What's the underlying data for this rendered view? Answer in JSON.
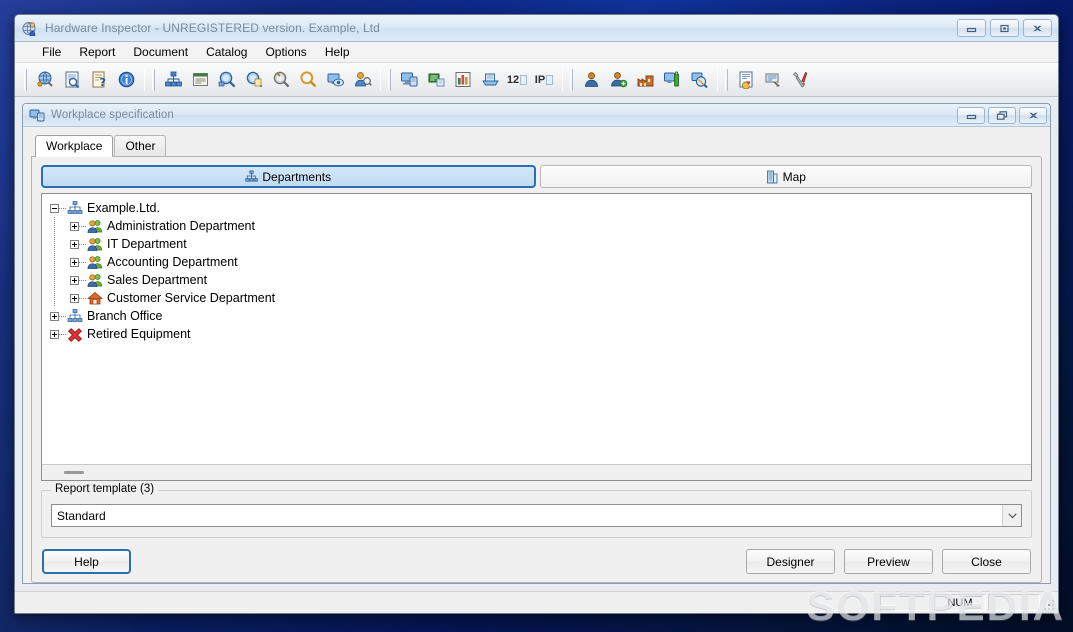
{
  "window": {
    "title": "Hardware Inspector - UNREGISTERED version. Example, Ltd",
    "icon": "app-globe-person-icon",
    "controls": {
      "minimize": "Minimize",
      "restore": "Restore",
      "close": "Close"
    }
  },
  "menubar": {
    "items": [
      {
        "label": "File"
      },
      {
        "label": "Report"
      },
      {
        "label": "Document"
      },
      {
        "label": "Catalog"
      },
      {
        "label": "Options"
      },
      {
        "label": "Help"
      }
    ]
  },
  "toolbar": {
    "groups": [
      {
        "buttons": [
          {
            "icon": "globe-network-icon",
            "name": "workplaces-button"
          },
          {
            "icon": "document-search-icon",
            "name": "document-preview-button"
          },
          {
            "icon": "document-question-icon",
            "name": "document-help-button"
          },
          {
            "icon": "info-circle-icon",
            "name": "info-button"
          }
        ]
      },
      {
        "buttons": [
          {
            "icon": "org-tree-icon",
            "name": "departments-button"
          },
          {
            "icon": "list-form-icon",
            "name": "list-button"
          },
          {
            "icon": "magnifier-blue-icon",
            "name": "find-equipment-button"
          },
          {
            "icon": "magnifier-doc-icon",
            "name": "find-document-button"
          },
          {
            "icon": "magnifier-gray-icon",
            "name": "find-other-button"
          },
          {
            "icon": "magnifier-plain-icon",
            "name": "search-button"
          },
          {
            "icon": "monitor-eye-icon",
            "name": "inventory-view-button"
          },
          {
            "icon": "user-search-icon",
            "name": "find-user-button"
          }
        ]
      },
      {
        "buttons": [
          {
            "icon": "monitor-blue-icon",
            "name": "equipment-button"
          },
          {
            "icon": "network-card-icon",
            "name": "network-button"
          },
          {
            "icon": "chart-bars-icon",
            "name": "statistics-button"
          },
          {
            "icon": "printer-icon",
            "name": "printer-button"
          },
          {
            "icon": "number-12-icon",
            "name": "numbering-button",
            "text": "12"
          },
          {
            "icon": "ip-address-icon",
            "name": "ip-address-button",
            "text": "IP"
          }
        ]
      },
      {
        "buttons": [
          {
            "icon": "user-icon",
            "name": "employees-button"
          },
          {
            "icon": "user-add-icon",
            "name": "add-employee-button"
          },
          {
            "icon": "factory-icon",
            "name": "vendors-button"
          },
          {
            "icon": "monitor-bottle-icon",
            "name": "supplies-button"
          },
          {
            "icon": "monitor-search-icon",
            "name": "equipment-search-button"
          }
        ]
      },
      {
        "buttons": [
          {
            "icon": "report-page-icon",
            "name": "reports-button"
          },
          {
            "icon": "report-export-icon",
            "name": "export-button"
          },
          {
            "icon": "tools-icon",
            "name": "settings-tools-button"
          }
        ]
      }
    ]
  },
  "child_window": {
    "title": "Workplace specification",
    "icon": "workplace-icon",
    "controls": {
      "minimize": "Minimize",
      "restore": "Restore",
      "close": "Close"
    },
    "tabs": [
      {
        "label": "Workplace",
        "active": true
      },
      {
        "label": "Other",
        "active": false
      }
    ],
    "view_selector": [
      {
        "label": "Departments",
        "icon": "org-tree-icon",
        "selected": true
      },
      {
        "label": "Map",
        "icon": "map-building-icon",
        "selected": false
      }
    ],
    "tree": [
      {
        "label": "Example.Ltd.",
        "level": 0,
        "icon": "org-tree-icon",
        "expander": "minus",
        "has_line": true
      },
      {
        "label": "Administration Department",
        "level": 1,
        "icon": "people-icon",
        "expander": "plus",
        "has_line": false
      },
      {
        "label": "IT Department",
        "level": 1,
        "icon": "people-icon",
        "expander": "plus",
        "has_line": false
      },
      {
        "label": "Accounting Department",
        "level": 1,
        "icon": "people-icon",
        "expander": "plus",
        "has_line": false
      },
      {
        "label": "Sales Department",
        "level": 1,
        "icon": "people-icon",
        "expander": "plus",
        "has_line": false
      },
      {
        "label": "Customer Service Department",
        "level": 1,
        "icon": "house-icon",
        "expander": "plus",
        "has_line": false
      },
      {
        "label": "Branch Office",
        "level": 0,
        "icon": "org-tree-icon",
        "expander": "plus",
        "has_line": false
      },
      {
        "label": "Retired Equipment",
        "level": 0,
        "icon": "red-cross-icon",
        "expander": "plus",
        "has_line": false
      }
    ],
    "report_group": {
      "legend": "Report template (3)",
      "selected_template": "Standard"
    },
    "buttons": {
      "help": "Help",
      "designer": "Designer",
      "preview": "Preview",
      "close": "Close"
    }
  },
  "statusbar": {
    "message": "",
    "num_indicator": "NUM"
  },
  "watermark": "SOFTPEDIA",
  "colors": {
    "accent": "#2a6fb5",
    "selected_tab_bg": "#bfdaf3",
    "window_bg": "#f0f0f0",
    "tree_bg": "#ffffff",
    "desktop": "#0b2ea8"
  }
}
